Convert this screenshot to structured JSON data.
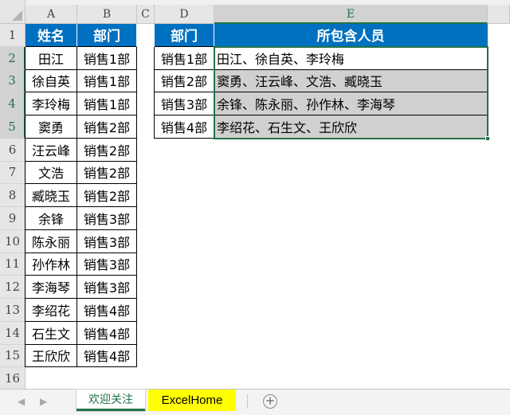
{
  "columns": [
    "A",
    "B",
    "C",
    "D",
    "E"
  ],
  "rows": [
    "1",
    "2",
    "3",
    "4",
    "5",
    "6",
    "7",
    "8",
    "9",
    "10",
    "11",
    "12",
    "13",
    "14",
    "15",
    "16"
  ],
  "table1": {
    "headers": [
      "姓名",
      "部门"
    ],
    "rows": [
      [
        "田江",
        "销售1部"
      ],
      [
        "徐自英",
        "销售1部"
      ],
      [
        "李玲梅",
        "销售1部"
      ],
      [
        "窦勇",
        "销售2部"
      ],
      [
        "汪云峰",
        "销售2部"
      ],
      [
        "文浩",
        "销售2部"
      ],
      [
        "臧晓玉",
        "销售2部"
      ],
      [
        "余锋",
        "销售3部"
      ],
      [
        "陈永丽",
        "销售3部"
      ],
      [
        "孙作林",
        "销售3部"
      ],
      [
        "李海琴",
        "销售3部"
      ],
      [
        "李绍花",
        "销售4部"
      ],
      [
        "石生文",
        "销售4部"
      ],
      [
        "王欣欣",
        "销售4部"
      ]
    ]
  },
  "table2": {
    "headers": [
      "部门",
      "所包含人员"
    ],
    "rows": [
      [
        "销售1部",
        "田江、徐自英、李玲梅"
      ],
      [
        "销售2部",
        "窦勇、汪云峰、文浩、臧晓玉"
      ],
      [
        "销售3部",
        "余锋、陈永丽、孙作林、李海琴"
      ],
      [
        "销售4部",
        "李绍花、石生文、王欣欣"
      ]
    ]
  },
  "tabs": {
    "nav_prev": "◀",
    "nav_next": "▶",
    "sheet1": "欢迎关注",
    "sheet2": "ExcelHome",
    "add": "+"
  },
  "colors": {
    "header_blue": "#0070c0",
    "excel_green": "#217346",
    "tab_highlight": "#ffff00"
  }
}
